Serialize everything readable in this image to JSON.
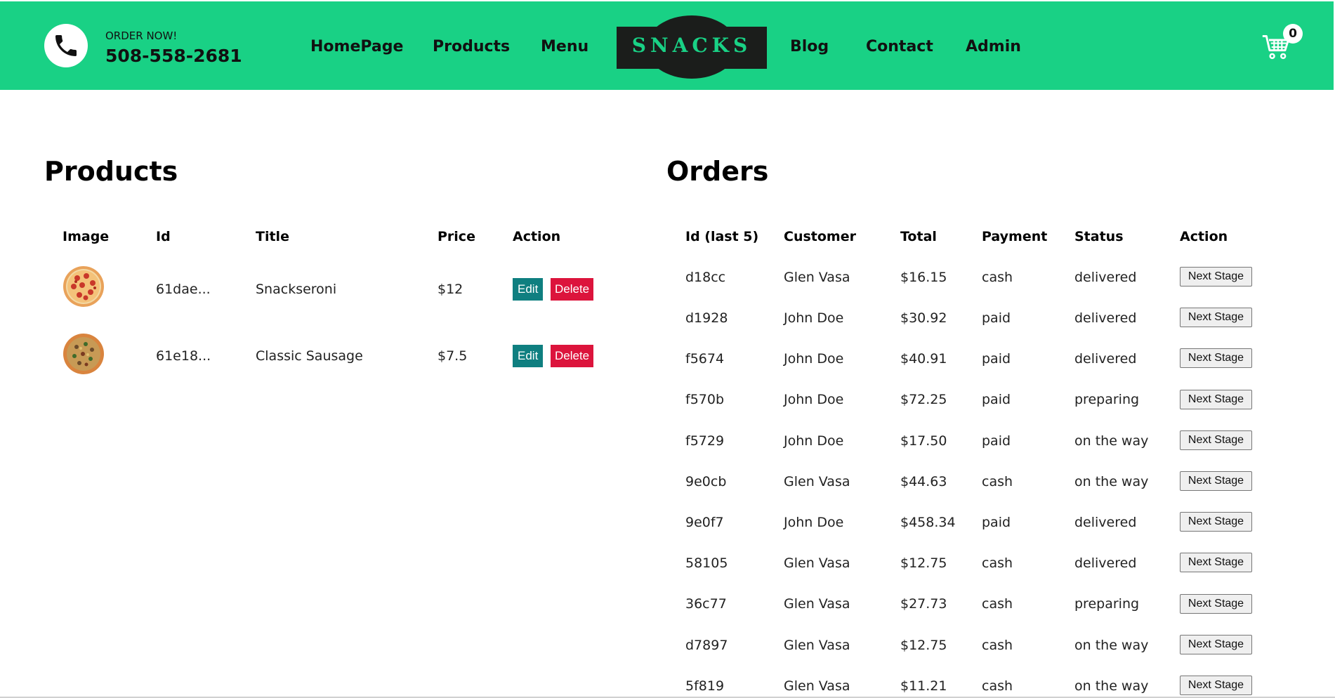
{
  "header": {
    "order_now": "ORDER NOW!",
    "phone": "508-558-2681",
    "nav_left": [
      "HomePage",
      "Products",
      "Menu"
    ],
    "logo": "SNACKS",
    "nav_right": [
      "Blog",
      "Contact",
      "Admin"
    ],
    "cart_count": "0",
    "bg_color": "#19d185"
  },
  "products": {
    "title": "Products",
    "columns": [
      "Image",
      "Id",
      "Title",
      "Price",
      "Action"
    ],
    "rows": [
      {
        "image": "pepperoni-pizza-image",
        "id": "61dae...",
        "title": "Snackseroni",
        "price": "$12",
        "edit": "Edit",
        "delete": "Delete"
      },
      {
        "image": "sausage-pizza-image",
        "id": "61e18...",
        "title": "Classic Sausage",
        "price": "$7.5",
        "edit": "Edit",
        "delete": "Delete"
      }
    ],
    "edit_color": "#0f7f80",
    "delete_color": "#dc143c"
  },
  "orders": {
    "title": "Orders",
    "columns": [
      "Id (last 5)",
      "Customer",
      "Total",
      "Payment",
      "Status",
      "Action"
    ],
    "rows": [
      {
        "id": "d18cc",
        "customer": "Glen Vasa",
        "total": "$16.15",
        "payment": "cash",
        "status": "delivered",
        "action": "Next Stage"
      },
      {
        "id": "d1928",
        "customer": "John Doe",
        "total": "$30.92",
        "payment": "paid",
        "status": "delivered",
        "action": "Next Stage"
      },
      {
        "id": "f5674",
        "customer": "John Doe",
        "total": "$40.91",
        "payment": "paid",
        "status": "delivered",
        "action": "Next Stage"
      },
      {
        "id": "f570b",
        "customer": "John Doe",
        "total": "$72.25",
        "payment": "paid",
        "status": "preparing",
        "action": "Next Stage"
      },
      {
        "id": "f5729",
        "customer": "John Doe",
        "total": "$17.50",
        "payment": "paid",
        "status": "on the way",
        "action": "Next Stage"
      },
      {
        "id": "9e0cb",
        "customer": "Glen Vasa",
        "total": "$44.63",
        "payment": "cash",
        "status": "on the way",
        "action": "Next Stage"
      },
      {
        "id": "9e0f7",
        "customer": "John Doe",
        "total": "$458.34",
        "payment": "paid",
        "status": "delivered",
        "action": "Next Stage"
      },
      {
        "id": "58105",
        "customer": "Glen Vasa",
        "total": "$12.75",
        "payment": "cash",
        "status": "delivered",
        "action": "Next Stage"
      },
      {
        "id": "36c77",
        "customer": "Glen Vasa",
        "total": "$27.73",
        "payment": "cash",
        "status": "preparing",
        "action": "Next Stage"
      },
      {
        "id": "d7897",
        "customer": "Glen Vasa",
        "total": "$12.75",
        "payment": "cash",
        "status": "on the way",
        "action": "Next Stage"
      },
      {
        "id": "5f819",
        "customer": "Glen Vasa",
        "total": "$11.21",
        "payment": "cash",
        "status": "on the way",
        "action": "Next Stage"
      }
    ]
  }
}
